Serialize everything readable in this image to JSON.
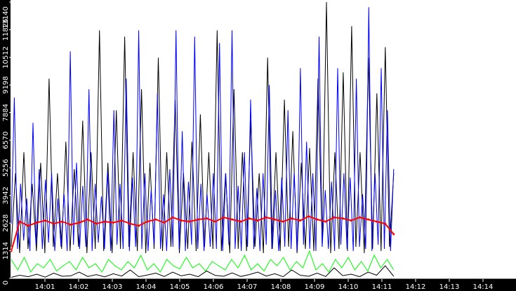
{
  "chart_data": {
    "type": "line",
    "title": "",
    "xlabel": "",
    "ylabel": "",
    "ylim": [
      0,
      13140
    ],
    "xlim_minutes": [
      0,
      15
    ],
    "data_end_minute": 11.37,
    "y_ticks": [
      "0",
      "1314",
      "2628",
      "3942",
      "5256",
      "6570",
      "7884",
      "9198",
      "10512",
      "11826",
      "13140"
    ],
    "x_ticks": [
      "14:01",
      "14:02",
      "14:03",
      "14:04",
      "14:05",
      "14:06",
      "14:07",
      "14:08",
      "14:09",
      "14:10",
      "14:11",
      "14:12",
      "14:13",
      "14:14"
    ],
    "grid": false,
    "legend": "none",
    "series": [
      {
        "name": "black-peaks",
        "color": "#000000",
        "values": [
          1500,
          5000,
          1200,
          6000,
          1400,
          4500,
          1300,
          5500,
          1200,
          9500,
          1500,
          5000,
          1400,
          6500,
          1300,
          5200,
          1500,
          7500,
          1200,
          6000,
          1400,
          11800,
          1300,
          5500,
          1200,
          8000,
          1400,
          11500,
          1500,
          6000,
          1300,
          9000,
          1200,
          5500,
          1400,
          10500,
          1300,
          6000,
          1500,
          8500,
          1200,
          5000,
          1400,
          6500,
          1300,
          7800,
          1500,
          6000,
          1400,
          11800,
          1300,
          5000,
          1200,
          9000,
          1400,
          6000,
          1300,
          7500,
          1500,
          5000,
          1200,
          10500,
          1400,
          6000,
          1300,
          8500,
          1500,
          7000,
          1200,
          5500,
          1400,
          6200,
          1300,
          9500,
          1500,
          13140,
          1200,
          6000,
          1400,
          9800,
          1300,
          12000,
          1500,
          6000,
          1200,
          10500,
          1400,
          8800,
          1300,
          11000,
          1500,
          5000
        ]
      },
      {
        "name": "blue",
        "color": "#0000ff",
        "values": [
          2600,
          8600,
          1400,
          4500,
          1800,
          3800,
          1300,
          7400,
          1600,
          5200,
          1400,
          4700,
          1700,
          5000,
          1300,
          3800,
          1500,
          4000,
          1300,
          10800,
          1600,
          5500,
          1400,
          4400,
          1500,
          9000,
          1300,
          4500,
          1700,
          3900,
          1400,
          5100,
          1300,
          8000,
          1600,
          4500,
          1400,
          9500,
          1300,
          4800,
          1500,
          11800,
          1400,
          5000,
          1300,
          4200,
          1600,
          8800,
          1400,
          4000,
          1300,
          5200,
          1500,
          11800,
          1400,
          7000,
          1300,
          4600,
          1600,
          11500,
          1400,
          4500,
          1300,
          4000,
          1500,
          5000,
          1400,
          11200,
          1300,
          5000,
          1600,
          11800,
          1400,
          4400,
          1300,
          6000,
          1500,
          8500,
          1400,
          4300,
          1300,
          5000,
          1600,
          9200,
          1400,
          4200,
          1300,
          4800,
          1500,
          8000,
          1400,
          5000,
          1300,
          10000,
          1600,
          6500,
          1400,
          5000,
          1300,
          11500,
          1500,
          4200,
          1400,
          4600,
          1300,
          10000,
          1600,
          5000,
          1400,
          4800,
          1300,
          9500,
          1500,
          4000,
          1400,
          12900,
          1300,
          5000,
          1600,
          10000,
          1400,
          8000,
          1300,
          5200
        ]
      },
      {
        "name": "green",
        "color": "#00ff00",
        "values": [
          900,
          400,
          1000,
          300,
          700,
          500,
          900,
          350,
          600,
          800,
          400,
          1000,
          500,
          700,
          300,
          900,
          600,
          400,
          800,
          500,
          1100,
          400,
          700,
          300,
          900,
          600,
          450,
          1000,
          500,
          700,
          350,
          800,
          600,
          400,
          900,
          500,
          1100,
          400,
          700,
          350,
          900,
          600,
          1000,
          400,
          800,
          500,
          1300,
          400,
          700,
          300,
          900,
          500,
          1000,
          400,
          800,
          350,
          1100,
          500,
          900,
          400
        ]
      },
      {
        "name": "red",
        "color": "#ff0000",
        "values": [
          1300,
          2700,
          2500,
          2650,
          2750,
          2600,
          2700,
          2550,
          2650,
          2800,
          2600,
          2700,
          2650,
          2750,
          2600,
          2500,
          2700,
          2800,
          2650,
          2900,
          2750,
          2700,
          2800,
          2850,
          2700,
          2900,
          2800,
          2700,
          2850,
          2750,
          2900,
          2800,
          2700,
          2850,
          2750,
          2950,
          2800,
          2700,
          2900,
          2850,
          2750,
          2900,
          2800,
          2700,
          2600,
          2100
        ]
      },
      {
        "name": "black-baseline",
        "color": "#000000",
        "values": [
          50,
          150,
          80,
          200,
          60,
          250,
          100,
          120,
          300,
          90,
          180,
          70,
          220,
          110,
          400,
          80,
          160,
          250,
          90,
          300,
          120,
          200,
          80,
          350,
          140,
          100,
          260,
          90,
          180,
          300,
          110,
          220,
          80,
          400,
          150,
          100,
          250,
          90,
          500,
          130,
          200,
          80,
          300,
          150,
          600,
          100
        ]
      }
    ]
  }
}
